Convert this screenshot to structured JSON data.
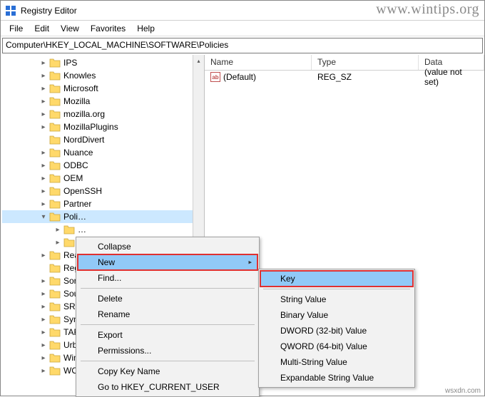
{
  "window": {
    "title": "Registry Editor"
  },
  "menu": {
    "file": "File",
    "edit": "Edit",
    "view": "View",
    "favorites": "Favorites",
    "help": "Help"
  },
  "address": "Computer\\HKEY_LOCAL_MACHINE\\SOFTWARE\\Policies",
  "tree": {
    "items": [
      {
        "label": "IPS",
        "exp": "▸",
        "child": false
      },
      {
        "label": "Knowles",
        "exp": "▸",
        "child": false
      },
      {
        "label": "Microsoft",
        "exp": "▸",
        "child": false
      },
      {
        "label": "Mozilla",
        "exp": "▸",
        "child": false
      },
      {
        "label": "mozilla.org",
        "exp": "▸",
        "child": false
      },
      {
        "label": "MozillaPlugins",
        "exp": "▸",
        "child": false
      },
      {
        "label": "NordDivert",
        "exp": "",
        "child": false
      },
      {
        "label": "Nuance",
        "exp": "▸",
        "child": false
      },
      {
        "label": "ODBC",
        "exp": "▸",
        "child": false
      },
      {
        "label": "OEM",
        "exp": "▸",
        "child": false
      },
      {
        "label": "OpenSSH",
        "exp": "▸",
        "child": false
      },
      {
        "label": "Partner",
        "exp": "▸",
        "child": false
      },
      {
        "label": "Poli…",
        "exp": "▾",
        "child": false,
        "selected": true
      },
      {
        "label": "…",
        "exp": "▸",
        "child": true
      },
      {
        "label": "…",
        "exp": "▸",
        "child": true
      },
      {
        "label": "Rea…",
        "exp": "▸",
        "child": false
      },
      {
        "label": "Reg…",
        "exp": "",
        "child": false
      },
      {
        "label": "Sor…",
        "exp": "▸",
        "child": false
      },
      {
        "label": "Sou…",
        "exp": "▸",
        "child": false
      },
      {
        "label": "SRS…",
        "exp": "▸",
        "child": false
      },
      {
        "label": "Syn…",
        "exp": "▸",
        "child": false
      },
      {
        "label": "TAR…",
        "exp": "▸",
        "child": false
      },
      {
        "label": "Urb…",
        "exp": "▸",
        "child": false
      },
      {
        "label": "Win…",
        "exp": "▸",
        "child": false
      },
      {
        "label": "WO…",
        "exp": "▸",
        "child": false
      }
    ]
  },
  "list": {
    "headers": {
      "name": "Name",
      "type": "Type",
      "data": "Data"
    },
    "rows": [
      {
        "name": "(Default)",
        "type": "REG_SZ",
        "data": "(value not set)"
      }
    ]
  },
  "context_menu": {
    "collapse": "Collapse",
    "new": "New",
    "find": "Find...",
    "delete": "Delete",
    "rename": "Rename",
    "export": "Export",
    "permissions": "Permissions...",
    "copy_key_name": "Copy Key Name",
    "go_to": "Go to HKEY_CURRENT_USER"
  },
  "submenu": {
    "key": "Key",
    "string": "String Value",
    "binary": "Binary Value",
    "dword": "DWORD (32-bit) Value",
    "qword": "QWORD (64-bit) Value",
    "multi_string": "Multi-String Value",
    "exp_string": "Expandable String Value"
  },
  "watermark": "www.wintips.org",
  "footer": "wsxdn.com"
}
